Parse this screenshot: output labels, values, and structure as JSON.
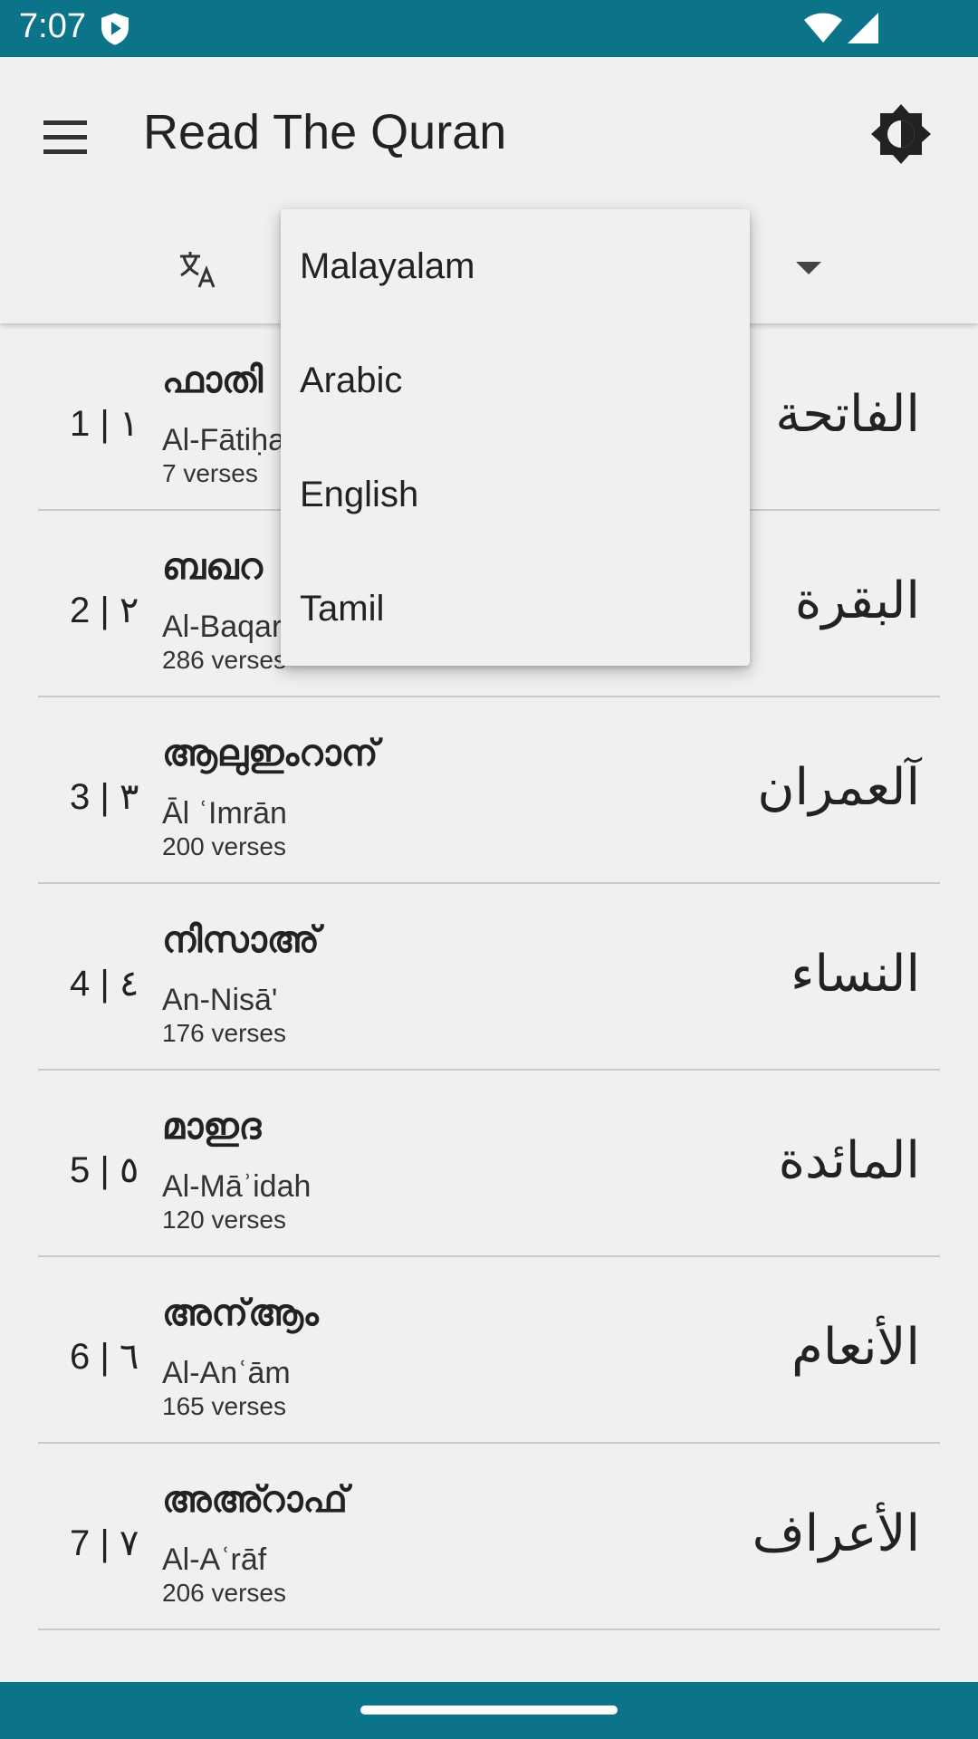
{
  "status": {
    "time": "7:07",
    "icons": [
      "shield-icon",
      "wifi-icon",
      "signal-icon"
    ]
  },
  "app_bar": {
    "title": "Read The Quran",
    "icons": [
      "menu-icon",
      "brightness-icon",
      "translate-icon",
      "dropdown-arrow-icon"
    ]
  },
  "colors": {
    "accent": "#0b7489",
    "background": "#eff1ef",
    "divider": "#c9cac9"
  },
  "menu": {
    "items": [
      "Malayalam",
      "Arabic",
      "English",
      "Tamil"
    ]
  },
  "surahs": [
    {
      "num": "1 | ١",
      "ml": "ഫാതി",
      "translit": "Al-Fātiḥa",
      "verses": "7 verses",
      "ar": "الفاتحة"
    },
    {
      "num": "2 | ٢",
      "ml": "ബഖറ",
      "translit": "Al-Baqar",
      "verses": "286 verses",
      "ar": "البقرة"
    },
    {
      "num": "3 | ٣",
      "ml": "ആലുഇംറാന്",
      "translit": "Āl ʿImrān",
      "verses": "200 verses",
      "ar": "آلعمران"
    },
    {
      "num": "4 | ٤",
      "ml": "നിസാഅ്",
      "translit": "An-Nisā'",
      "verses": "176 verses",
      "ar": "النساء"
    },
    {
      "num": "5 | ٥",
      "ml": "മാഇദ",
      "translit": "Al-Māʾidah",
      "verses": "120 verses",
      "ar": "المائدة"
    },
    {
      "num": "6 | ٦",
      "ml": "അന്ആം",
      "translit": "Al-Anʿām",
      "verses": "165 verses",
      "ar": "الأنعام"
    },
    {
      "num": "7 | ٧",
      "ml": "അഅ്റാഫ്",
      "translit": "Al-Aʿrāf",
      "verses": "206 verses",
      "ar": "الأعراف"
    }
  ]
}
